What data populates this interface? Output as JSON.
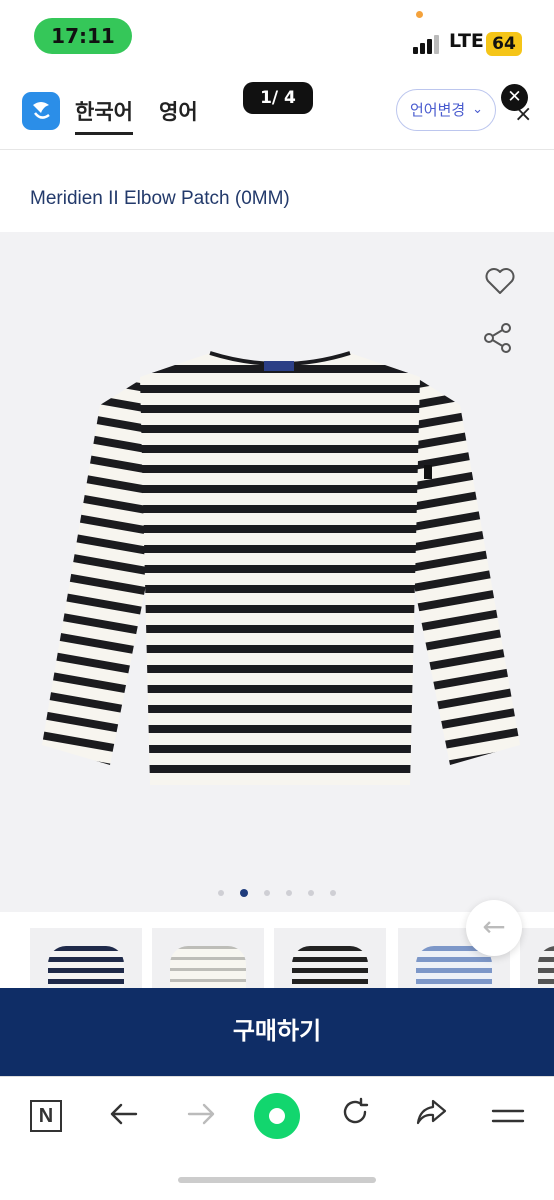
{
  "status_bar": {
    "time": "17:11",
    "network": "LTE",
    "battery": "64"
  },
  "header": {
    "tabs": [
      {
        "label": "한국어",
        "active": true
      },
      {
        "label": "영어",
        "active": false
      }
    ],
    "page_indicator": "1/ 4",
    "language_change_label": "언어변경",
    "close_label": "×",
    "close_circle_label": "✕"
  },
  "product": {
    "title": "Meridien II Elbow Patch (0MM)",
    "image_count": 6,
    "active_image_index": 1
  },
  "actions": {
    "buy_label": "구매하기"
  },
  "browser_nav": {
    "n_label": "N",
    "items": [
      "back-icon",
      "forward-icon",
      "home-icon",
      "refresh-icon",
      "share-icon",
      "menu-icon"
    ]
  },
  "colors": {
    "brand_navy": "#0f2d66",
    "accent_blue": "#4a5ccf",
    "home_green": "#12d66e",
    "time_pill_green": "#35c759",
    "battery_yellow": "#f5c518"
  }
}
